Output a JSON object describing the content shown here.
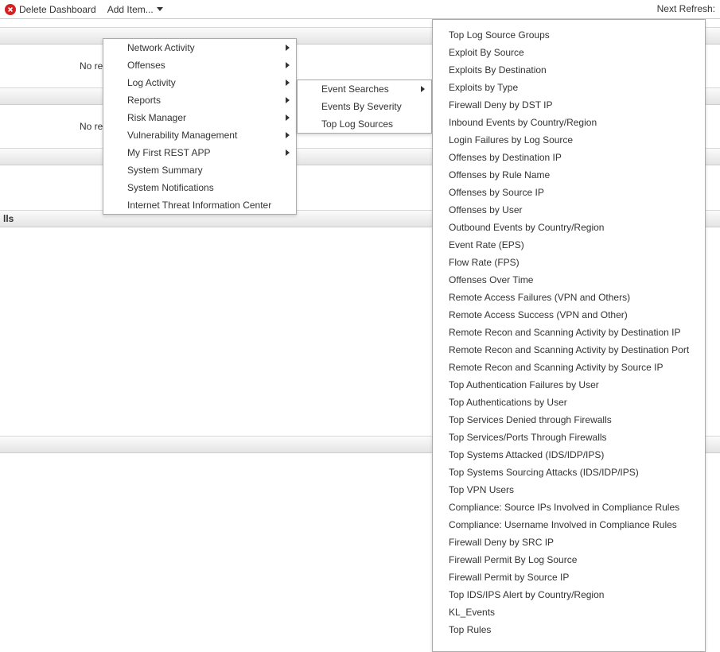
{
  "toolbar": {
    "delete_label": "Delete Dashboard",
    "add_label": "Add Item...",
    "next_refresh_label": "Next Refresh:"
  },
  "panels": {
    "no_results": "No res",
    "firewalls_suffix": "lls"
  },
  "menu1": {
    "items": [
      {
        "label": "Network Activity",
        "sub": true
      },
      {
        "label": "Offenses",
        "sub": true
      },
      {
        "label": "Log Activity",
        "sub": true
      },
      {
        "label": "Reports",
        "sub": true
      },
      {
        "label": "Risk Manager",
        "sub": true
      },
      {
        "label": "Vulnerability Management",
        "sub": true
      },
      {
        "label": "My First REST APP",
        "sub": true
      },
      {
        "label": "System Summary",
        "sub": false
      },
      {
        "label": "System Notifications",
        "sub": false
      },
      {
        "label": "Internet Threat Information Center",
        "sub": false
      }
    ]
  },
  "menu2": {
    "items": [
      {
        "label": "Event Searches",
        "sub": true
      },
      {
        "label": "Events By Severity",
        "sub": false
      },
      {
        "label": "Top Log Sources",
        "sub": false
      }
    ]
  },
  "menu3": {
    "items": [
      "Top Log Source Groups",
      "Exploit By Source",
      "Exploits By Destination",
      "Exploits by Type",
      "Firewall Deny by DST IP",
      "Inbound Events by Country/Region",
      "Login Failures by Log Source",
      "Offenses by Destination IP",
      "Offenses by Rule Name",
      "Offenses by Source IP",
      "Offenses by User",
      "Outbound Events by Country/Region",
      "Event Rate (EPS)",
      "Flow Rate (FPS)",
      "Offenses Over Time",
      "Remote Access Failures (VPN and Others)",
      "Remote Access Success (VPN and Other)",
      "Remote Recon and Scanning Activity by Destination IP",
      "Remote Recon and Scanning Activity by Destination Port",
      "Remote Recon and Scanning Activity by Source IP",
      "Top Authentication Failures by User",
      "Top Authentications by User",
      "Top Services Denied through Firewalls",
      "Top Services/Ports Through Firewalls",
      "Top Systems Attacked (IDS/IDP/IPS)",
      "Top Systems Sourcing Attacks (IDS/IDP/IPS)",
      "Top VPN Users",
      "Compliance: Source IPs Involved in Compliance Rules",
      "Compliance: Username Involved in Compliance Rules",
      "Firewall Deny by SRC IP",
      "Firewall Permit By Log Source",
      "Firewall Permit by Source IP",
      "Top IDS/IPS Alert by Country/Region",
      "KL_Events",
      "Top Rules"
    ]
  }
}
